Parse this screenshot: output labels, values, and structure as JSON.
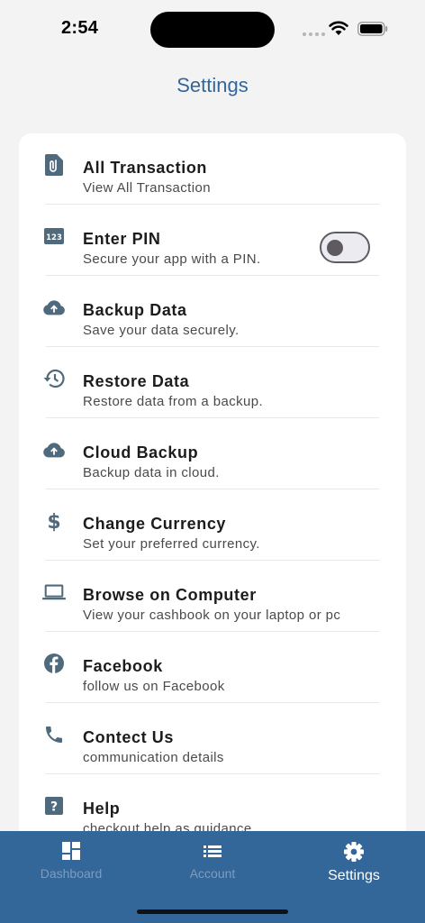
{
  "status_bar": {
    "time": "2:54"
  },
  "header": {
    "title": "Settings"
  },
  "settings": {
    "items": [
      {
        "label": "All Transaction",
        "sub": "View All Transaction",
        "icon": "file-attachment-icon"
      },
      {
        "label": "Enter PIN",
        "sub": "Secure your app with a PIN.",
        "icon": "pin-123-icon",
        "toggle": false
      },
      {
        "label": "Backup Data",
        "sub": "Save your data securely.",
        "icon": "cloud-upload-icon"
      },
      {
        "label": "Restore Data",
        "sub": "Restore data from a backup.",
        "icon": "history-icon"
      },
      {
        "label": "Cloud Backup",
        "sub": "Backup data in cloud.",
        "icon": "cloud-upload-icon"
      },
      {
        "label": "Change Currency",
        "sub": "Set your preferred currency.",
        "icon": "dollar-icon"
      },
      {
        "label": "Browse on Computer",
        "sub": "View your cashbook on your laptop or pc",
        "icon": "laptop-icon"
      },
      {
        "label": "Facebook",
        "sub": "follow us on Facebook",
        "icon": "facebook-icon"
      },
      {
        "label": "Contect Us",
        "sub": "communication details",
        "icon": "phone-icon"
      },
      {
        "label": "Help",
        "sub": "checkout help as guidance",
        "icon": "help-icon"
      }
    ]
  },
  "bottom_nav": {
    "items": [
      {
        "label": "Dashboard",
        "icon": "dashboard-icon",
        "active": false
      },
      {
        "label": "Account",
        "icon": "list-icon",
        "active": false
      },
      {
        "label": "Settings",
        "icon": "gear-icon",
        "active": true
      }
    ]
  },
  "colors": {
    "accent": "#336699",
    "icon": "#4f6a7c",
    "nav_inactive": "#7e9cbd"
  }
}
